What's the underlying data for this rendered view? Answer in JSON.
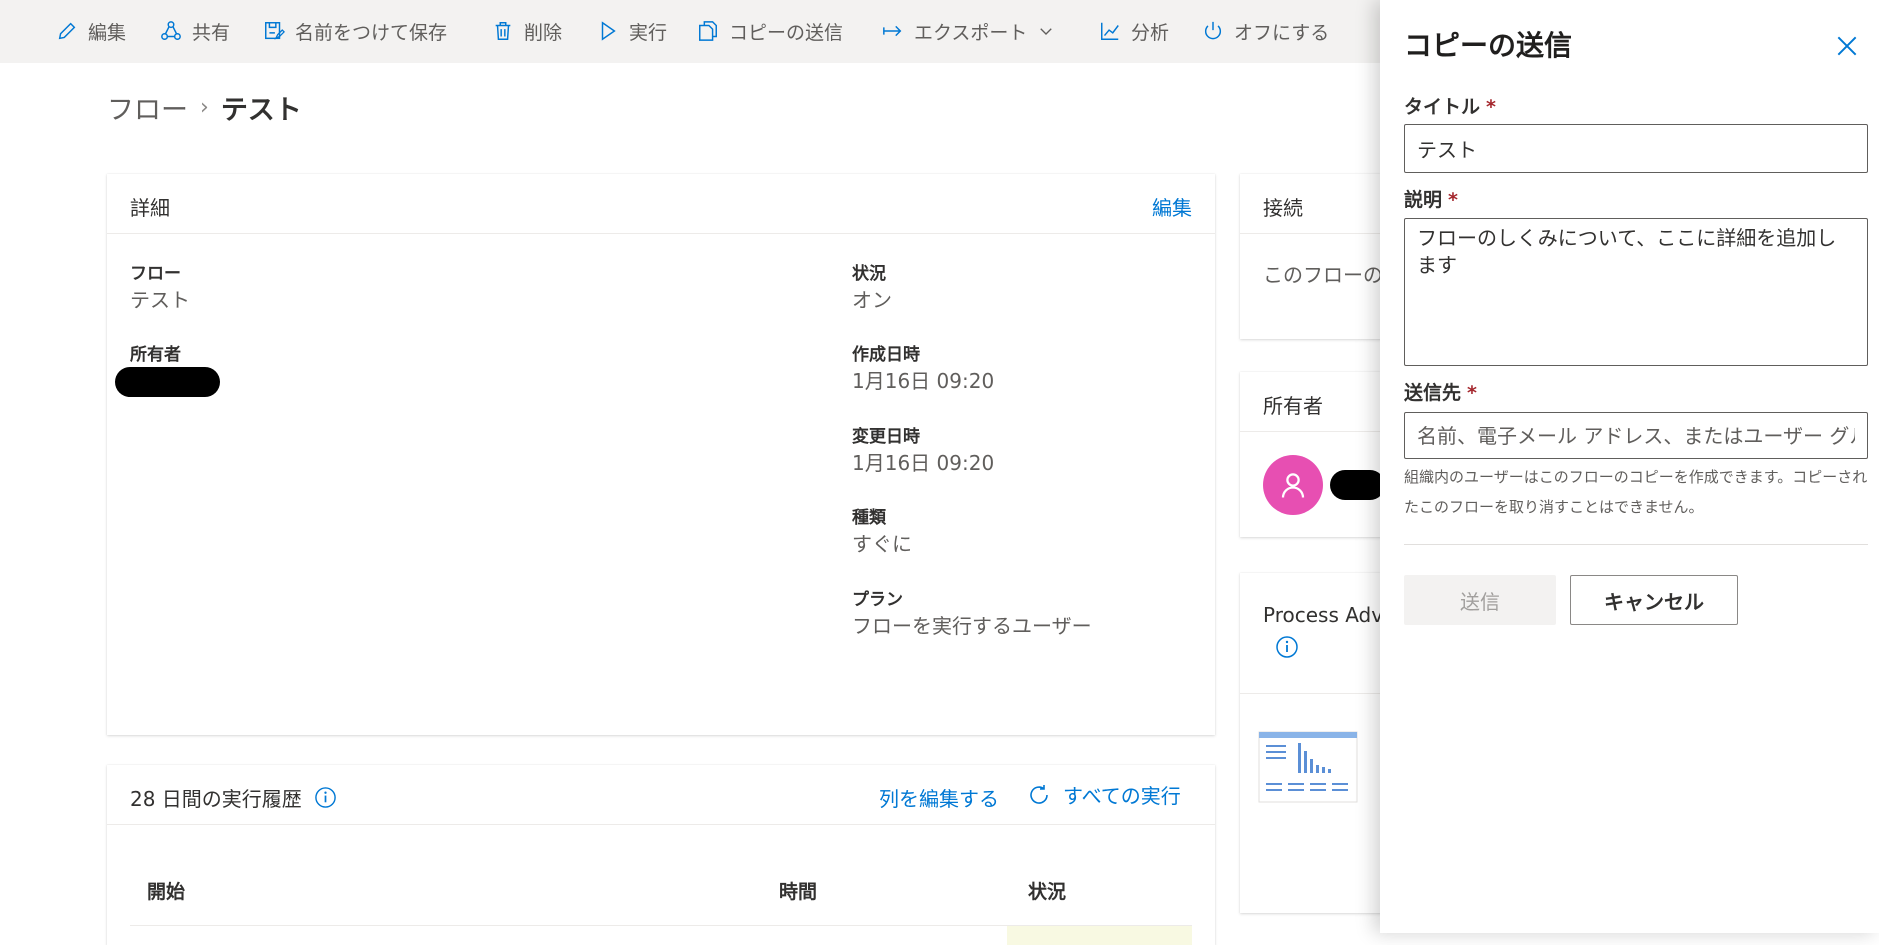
{
  "toolbar": {
    "items": [
      {
        "label": "編集",
        "icon": "pencil-icon"
      },
      {
        "label": "共有",
        "icon": "share-icon"
      },
      {
        "label": "名前をつけて保存",
        "icon": "save-as-icon"
      },
      {
        "label": "削除",
        "icon": "trash-icon"
      },
      {
        "label": "実行",
        "icon": "play-icon"
      },
      {
        "label": "コピーの送信",
        "icon": "copy-icon"
      },
      {
        "label": "エクスポート",
        "icon": "export-icon"
      },
      {
        "label": "分析",
        "icon": "analytics-icon"
      },
      {
        "label": "オフにする",
        "icon": "power-icon"
      }
    ]
  },
  "breadcrumb": {
    "root": "フロー",
    "current": "テスト"
  },
  "details": {
    "title": "詳細",
    "edit": "編集",
    "flow_label": "フロー",
    "flow_value": "テスト",
    "owner_label": "所有者",
    "status_label": "状況",
    "status_value": "オン",
    "created_label": "作成日時",
    "created_value": "1月16日 09:20",
    "modified_label": "変更日時",
    "modified_value": "1月16日 09:20",
    "type_label": "種類",
    "type_value": "すぐに",
    "plan_label": "プラン",
    "plan_value": "フローを実行するユーザー"
  },
  "connections": {
    "title": "接続",
    "text": "このフローの"
  },
  "owners": {
    "title": "所有者"
  },
  "process_advisor": {
    "title": "Process Adv"
  },
  "history": {
    "title": "28 日間の実行履歴",
    "edit_columns": "列を編集する",
    "all_runs": "すべての実行",
    "columns": [
      "開始",
      "時間",
      "状況"
    ]
  },
  "panel": {
    "title": "コピーの送信",
    "title_label": "タイトル",
    "title_value": "テスト",
    "desc_label": "説明",
    "desc_value": "フローのしくみについて、ここに詳細を追加します",
    "to_label": "送信先",
    "to_placeholder": "名前、電子メール アドレス、またはユーザー グループ",
    "hint": "組織内のユーザーはこのフローのコピーを作成できます。コピーされたこのフローを取り消すことはできません。",
    "send": "送信",
    "cancel": "キャンセル",
    "required_mark": "*"
  },
  "colors": {
    "accent": "#0078d4",
    "avatar": "#e74fb2",
    "required": "#a4262c"
  }
}
